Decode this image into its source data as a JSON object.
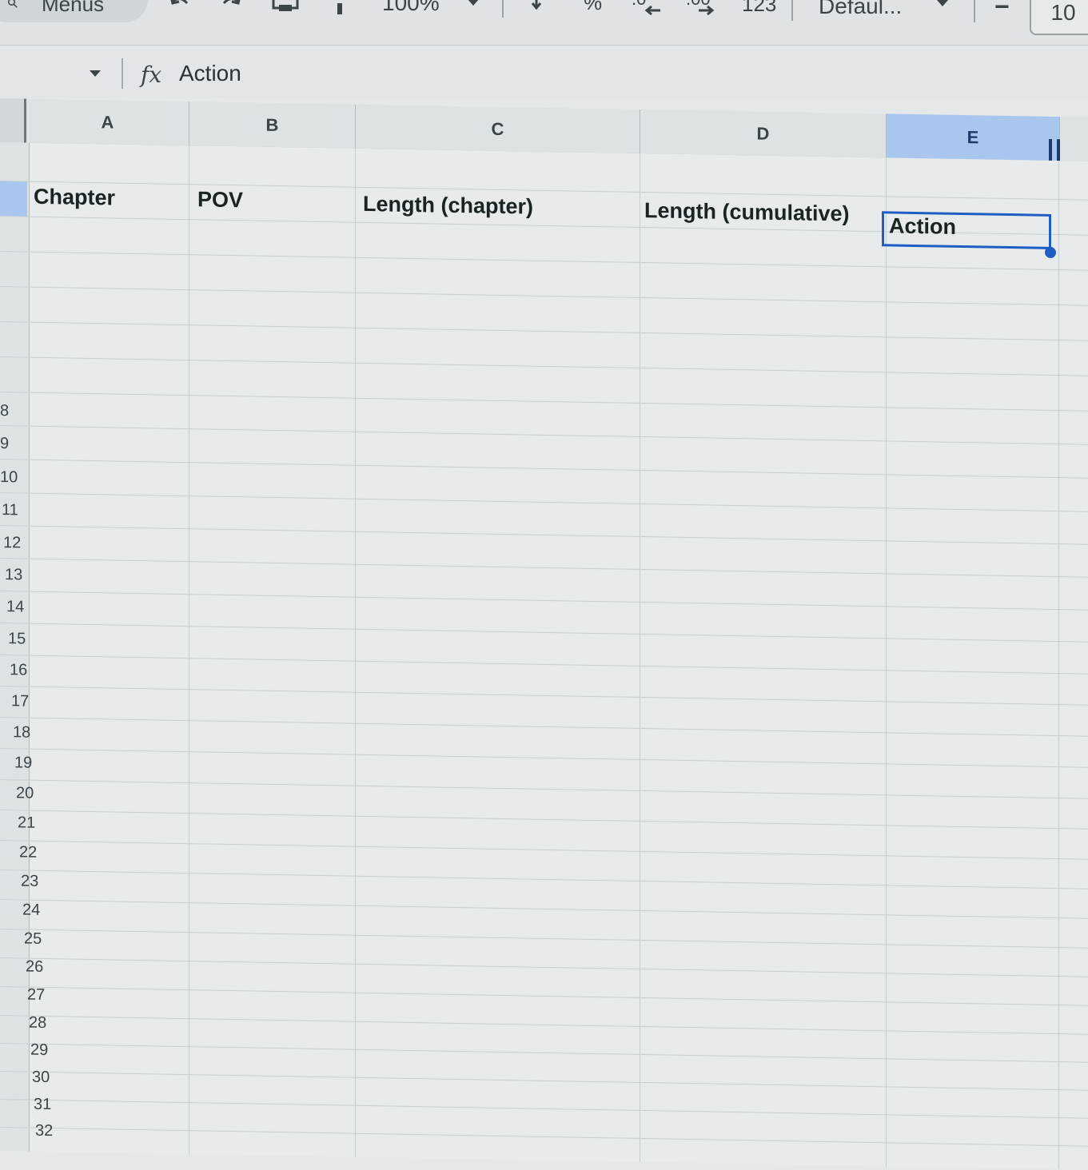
{
  "toolbar": {
    "menus_label": "Menus",
    "zoom": "100%",
    "percent_label": "%",
    "decrease_decimal_label": ".0",
    "increase_decimal_label": ".00",
    "format_label": "123",
    "font_name": "Defaul...",
    "font_size_minus": "−",
    "font_size": "10"
  },
  "formula_bar": {
    "fx": "fx",
    "value": "Action"
  },
  "columns": [
    "A",
    "B",
    "C",
    "D",
    "E"
  ],
  "selected_column": "E",
  "rows": [
    "8",
    "9",
    "10",
    "11",
    "12",
    "13",
    "14",
    "15",
    "16",
    "17",
    "18",
    "19",
    "20",
    "21",
    "22",
    "23",
    "24",
    "25",
    "26",
    "27",
    "28",
    "29",
    "30",
    "31",
    "32"
  ],
  "header_cells": {
    "a": "Chapter",
    "b": "POV",
    "c": "Length (chapter)",
    "d": "Length (cumulative)",
    "e": "Action"
  }
}
